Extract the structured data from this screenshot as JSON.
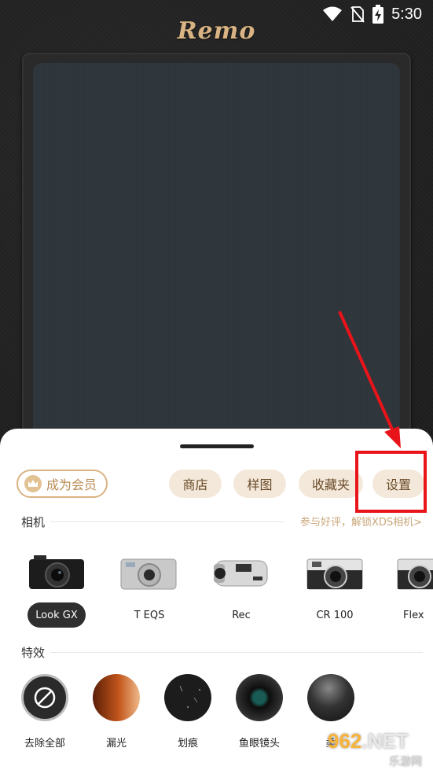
{
  "status_bar": {
    "time": "5:30",
    "icons": [
      "wifi-icon",
      "no-sim-icon",
      "battery-charging-icon"
    ]
  },
  "app": {
    "logo_text": "Remo"
  },
  "sheet": {
    "member_button": "成为会员",
    "menu": {
      "shop": "商店",
      "samples": "样图",
      "favorites": "收藏夹",
      "settings": "设置"
    },
    "cameras_section": {
      "title": "相机",
      "unlock_text": "参与好评，解锁XDS相机>",
      "items": [
        {
          "label": "Look GX",
          "selected": true
        },
        {
          "label": "T EQS",
          "selected": false
        },
        {
          "label": "Rec",
          "selected": false
        },
        {
          "label": "CR 100",
          "selected": false
        },
        {
          "label": "Flex",
          "selected": false
        }
      ]
    },
    "effects_section": {
      "title": "特效",
      "items": [
        {
          "label": "去除全部",
          "icon": "remove-all-icon"
        },
        {
          "label": "漏光",
          "icon": "light-leak-icon"
        },
        {
          "label": "划痕",
          "icon": "scratch-icon"
        },
        {
          "label": "鱼眼镜头",
          "icon": "fisheye-lens-icon"
        },
        {
          "label": "柔",
          "icon": "soft-focus-icon"
        }
      ]
    }
  },
  "watermark": {
    "number": "962",
    "domain": ".NET",
    "site": "乐游网"
  },
  "colors": {
    "accent_gold": "#d9b383",
    "annotation_red": "#e8141a",
    "pill_bg": "#f3e8da"
  }
}
